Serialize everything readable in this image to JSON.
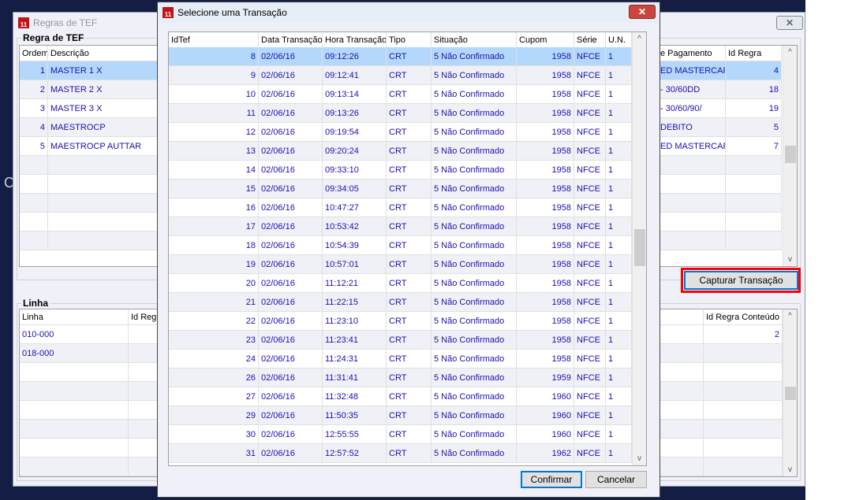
{
  "back_window": {
    "title": "Regras de TEF",
    "close": "✕",
    "group1": "Regra de TEF",
    "rules_headers": [
      "Ordem",
      "Descrição",
      "e Pagamento",
      "Id Regra"
    ],
    "rules": [
      [
        "1",
        "MASTER 1 X",
        "ED MASTERCARD",
        "4"
      ],
      [
        "2",
        "MASTER 2 X",
        "- 30/60DD",
        "18"
      ],
      [
        "3",
        "MASTER 3 X",
        "- 30/60/90/",
        "19"
      ],
      [
        "4",
        "MAESTROCP",
        "DEBITO",
        "5"
      ],
      [
        "5",
        "MAESTROCP AUTTAR",
        "ED MASTERCARD",
        "7"
      ]
    ],
    "capture_button": "Capturar Transação",
    "group2": "Linha",
    "lines_headers": [
      "Linha",
      "Id Regra",
      "Id Regra Conteúdo"
    ],
    "lines": [
      [
        "010-000",
        "",
        "2"
      ],
      [
        "018-000",
        "",
        ""
      ]
    ]
  },
  "dialog": {
    "title": "Selecione uma Transação",
    "close": "✕",
    "headers": [
      "IdTef",
      "Data Transação",
      "Hora Transação",
      "Tipo",
      "Situação",
      "Cupom",
      "Série",
      "U.N."
    ],
    "rows": [
      [
        "8",
        "02/06/16",
        "09:12:26",
        "CRT",
        "5 Não Confirmado",
        "1958",
        "NFCE",
        "1"
      ],
      [
        "9",
        "02/06/16",
        "09:12:41",
        "CRT",
        "5 Não Confirmado",
        "1958",
        "NFCE",
        "1"
      ],
      [
        "10",
        "02/06/16",
        "09:13:14",
        "CRT",
        "5 Não Confirmado",
        "1958",
        "NFCE",
        "1"
      ],
      [
        "11",
        "02/06/16",
        "09:13:26",
        "CRT",
        "5 Não Confirmado",
        "1958",
        "NFCE",
        "1"
      ],
      [
        "12",
        "02/06/16",
        "09:19:54",
        "CRT",
        "5 Não Confirmado",
        "1958",
        "NFCE",
        "1"
      ],
      [
        "13",
        "02/06/16",
        "09:20:24",
        "CRT",
        "5 Não Confirmado",
        "1958",
        "NFCE",
        "1"
      ],
      [
        "14",
        "02/06/16",
        "09:33:10",
        "CRT",
        "5 Não Confirmado",
        "1958",
        "NFCE",
        "1"
      ],
      [
        "15",
        "02/06/16",
        "09:34:05",
        "CRT",
        "5 Não Confirmado",
        "1958",
        "NFCE",
        "1"
      ],
      [
        "16",
        "02/06/16",
        "10:47:27",
        "CRT",
        "5 Não Confirmado",
        "1958",
        "NFCE",
        "1"
      ],
      [
        "17",
        "02/06/16",
        "10:53:42",
        "CRT",
        "5 Não Confirmado",
        "1958",
        "NFCE",
        "1"
      ],
      [
        "18",
        "02/06/16",
        "10:54:39",
        "CRT",
        "5 Não Confirmado",
        "1958",
        "NFCE",
        "1"
      ],
      [
        "19",
        "02/06/16",
        "10:57:01",
        "CRT",
        "5 Não Confirmado",
        "1958",
        "NFCE",
        "1"
      ],
      [
        "20",
        "02/06/16",
        "11:12:21",
        "CRT",
        "5 Não Confirmado",
        "1958",
        "NFCE",
        "1"
      ],
      [
        "21",
        "02/06/16",
        "11:22:15",
        "CRT",
        "5 Não Confirmado",
        "1958",
        "NFCE",
        "1"
      ],
      [
        "22",
        "02/06/16",
        "11:23:10",
        "CRT",
        "5 Não Confirmado",
        "1958",
        "NFCE",
        "1"
      ],
      [
        "23",
        "02/06/16",
        "11:23:41",
        "CRT",
        "5 Não Confirmado",
        "1958",
        "NFCE",
        "1"
      ],
      [
        "24",
        "02/06/16",
        "11:24:31",
        "CRT",
        "5 Não Confirmado",
        "1958",
        "NFCE",
        "1"
      ],
      [
        "26",
        "02/06/16",
        "11:31:41",
        "CRT",
        "5 Não Confirmado",
        "1959",
        "NFCE",
        "1"
      ],
      [
        "27",
        "02/06/16",
        "11:32:48",
        "CRT",
        "5 Não Confirmado",
        "1960",
        "NFCE",
        "1"
      ],
      [
        "29",
        "02/06/16",
        "11:50:35",
        "CRT",
        "5 Não Confirmado",
        "1960",
        "NFCE",
        "1"
      ],
      [
        "30",
        "02/06/16",
        "12:55:55",
        "CRT",
        "5 Não Confirmado",
        "1960",
        "NFCE",
        "1"
      ],
      [
        "31",
        "02/06/16",
        "12:57:52",
        "CRT",
        "5 Não Confirmado",
        "1962",
        "NFCE",
        "1"
      ]
    ],
    "confirm": "Confirmar",
    "cancel": "Cancelar"
  },
  "colors": {
    "highlight": "#ff0000",
    "selected": "#b4d8fb",
    "text": "#1a10b0"
  }
}
